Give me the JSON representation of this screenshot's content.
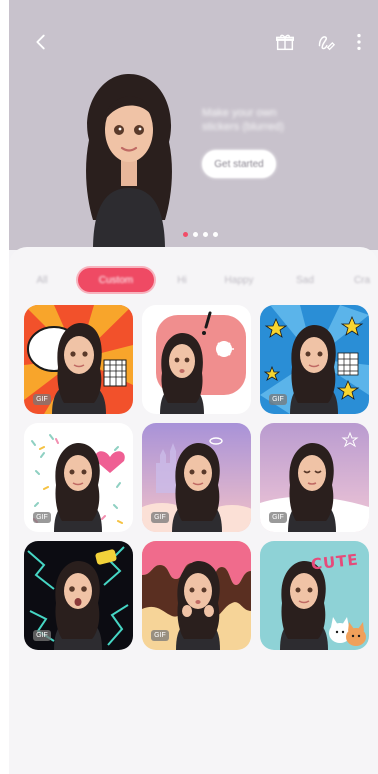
{
  "colors": {
    "hero_bg": "#c8c2cc",
    "accent": "#ef4a64",
    "panel_bg": "#f6f5f7"
  },
  "header": {
    "back_icon": "chevron-left-icon",
    "gift_icon": "gift-icon",
    "share_icon": "edit-share-icon",
    "more_icon": "more-vertical-icon"
  },
  "hero": {
    "promo_line_1": "Make your own",
    "promo_line_2": "stickers (blurred)",
    "promo_button": "Get started",
    "carousel_pages": 4,
    "carousel_active": 0
  },
  "tabs": [
    {
      "label": "All",
      "active": false
    },
    {
      "label": "Custom",
      "active": true
    },
    {
      "label": "Hi",
      "active": false
    },
    {
      "label": "Happy",
      "active": false
    },
    {
      "label": "Sad",
      "active": false
    },
    {
      "label": "Cra",
      "active": false
    }
  ],
  "stickers": [
    {
      "theme": "comic-explosion",
      "gif": "GIF"
    },
    {
      "theme": "pink-exclaim",
      "gif": ""
    },
    {
      "theme": "blue-stars",
      "gif": "GIF"
    },
    {
      "theme": "hearts",
      "gif": "GIF"
    },
    {
      "theme": "castle-clouds",
      "gif": "GIF"
    },
    {
      "theme": "snowy-night",
      "gif": "GIF"
    },
    {
      "theme": "lightning",
      "gif": "GIF"
    },
    {
      "theme": "dripping-chocolate",
      "gif": "GIF"
    },
    {
      "theme": "cute-cats",
      "gif": "",
      "caption": "CUTE"
    }
  ]
}
